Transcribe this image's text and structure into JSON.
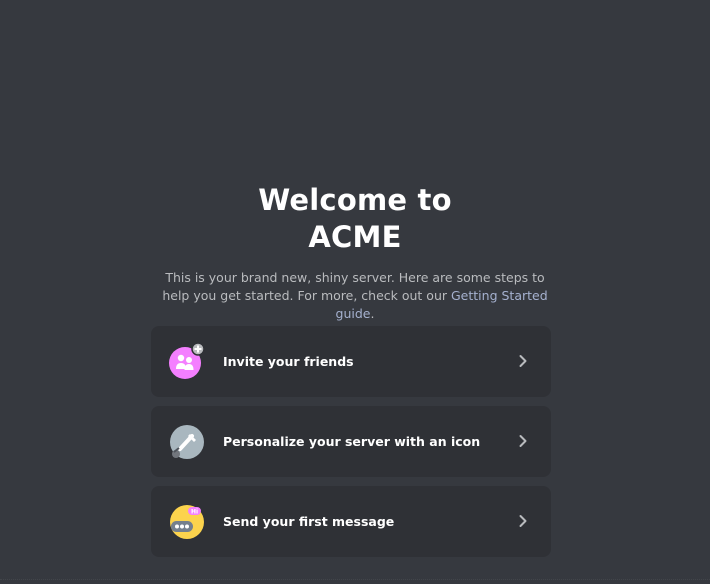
{
  "welcome": {
    "title_line1": "Welcome to",
    "title_line2": "ACME",
    "subtitle_text": "This is your brand new, shiny server. Here are some steps to help you get started. For more, check out our ",
    "guide_link": "Getting Started guide",
    "subtitle_end": "."
  },
  "cards": [
    {
      "label": "Invite your friends",
      "icon": "invite-friends-icon",
      "color": "#f47fff"
    },
    {
      "label": "Personalize your server with an icon",
      "icon": "personalize-icon",
      "color": "#a9b7bf"
    },
    {
      "label": "Send your first message",
      "icon": "first-message-icon",
      "color": "#faa61a"
    }
  ],
  "chevron_icon": "chevron-right-icon"
}
